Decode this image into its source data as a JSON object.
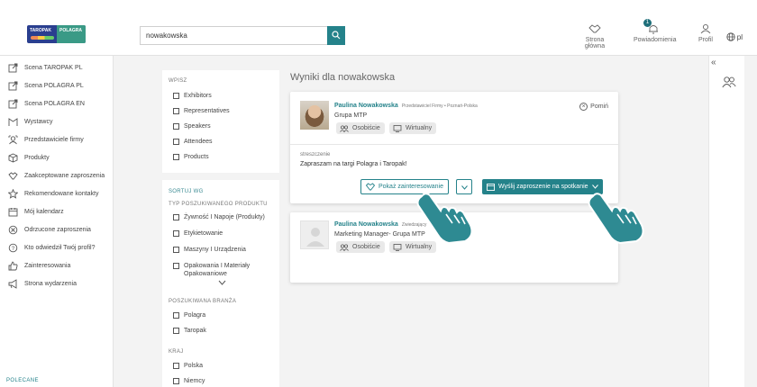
{
  "brand": {
    "logo_left": "TAROPAK",
    "logo_right": "POLAGRA",
    "colors": {
      "accent": "#24828a",
      "accent_dark": "#1f6f7a",
      "background": "#f3f3f3"
    }
  },
  "search": {
    "value": "nowakowska",
    "icon": "search-icon"
  },
  "topnav": {
    "home": "Strona główna",
    "notifications": "Powiadomienia",
    "notifications_count": "1",
    "profile": "Profil",
    "language": "pl"
  },
  "sidebar": {
    "items": [
      {
        "label": "Scena TAROPAK PL",
        "icon": "external-link-icon"
      },
      {
        "label": "Scena POLAGRA PL",
        "icon": "external-link-icon"
      },
      {
        "label": "Scena POLAGRA EN",
        "icon": "external-link-icon"
      },
      {
        "label": "Wystawcy",
        "icon": "booth-icon"
      },
      {
        "label": "Przedstawiciele firmy",
        "icon": "representative-icon"
      },
      {
        "label": "Produkty",
        "icon": "box-icon"
      },
      {
        "label": "Zaakceptowane zaproszenia",
        "icon": "handshake-icon"
      },
      {
        "label": "Rekomendowane kontakty",
        "icon": "star-icon"
      },
      {
        "label": "Mój kalendarz",
        "icon": "calendar-icon"
      },
      {
        "label": "Odrzucone zaproszenia",
        "icon": "rejected-icon"
      },
      {
        "label": "Kto odwiedził Twój profil?",
        "icon": "question-icon"
      },
      {
        "label": "Zainteresowania",
        "icon": "thumbs-up-icon"
      },
      {
        "label": "Strona wydarzenia",
        "icon": "megaphone-icon"
      }
    ],
    "footer": "POLECANE"
  },
  "filters": {
    "type_title": "WPISZ",
    "types": [
      "Exhibitors",
      "Representatives",
      "Speakers",
      "Attendees",
      "Products"
    ],
    "sort_title": "SORTUJ WG",
    "product_type_title": "TYP POSZUKIWANEGO PRODUKTU",
    "product_types": [
      "Żywność I Napoje (Produkty)",
      "Etykietowanie",
      "Maszyny I Urządzenia",
      "Opakowania I Materiały Opakowaniowe"
    ],
    "branch_title": "POSZUKIWANA BRANŻA",
    "branches": [
      "Polagra",
      "Taropak"
    ],
    "country_title": "KRAJ",
    "countries": [
      "Polska",
      "Niemcy"
    ]
  },
  "results": {
    "title": "Wyniki dla nowakowska",
    "cards": [
      {
        "name": "Paulina Nowakowska",
        "role": "Przedstawiciel Firmy • Poznań-Polska",
        "company": "Grupa MTP",
        "chips": [
          "Osobiście",
          "Wirtualny"
        ],
        "skip": "Pomiń",
        "summary_label": "streszczenie",
        "summary": "Zapraszam na targi Polagra i Taropak!",
        "show_interest": "Pokaż zainteresowanie",
        "send_invite": "Wyślij zaproszenie na spotkanie"
      },
      {
        "name": "Paulina Nowakowska",
        "role": "Zwiedzający",
        "company": "Marketing Manager- Grupa MTP",
        "chips": [
          "Osobiście",
          "Wirtualny"
        ]
      }
    ]
  },
  "right_rail": {
    "collapse": "«"
  }
}
